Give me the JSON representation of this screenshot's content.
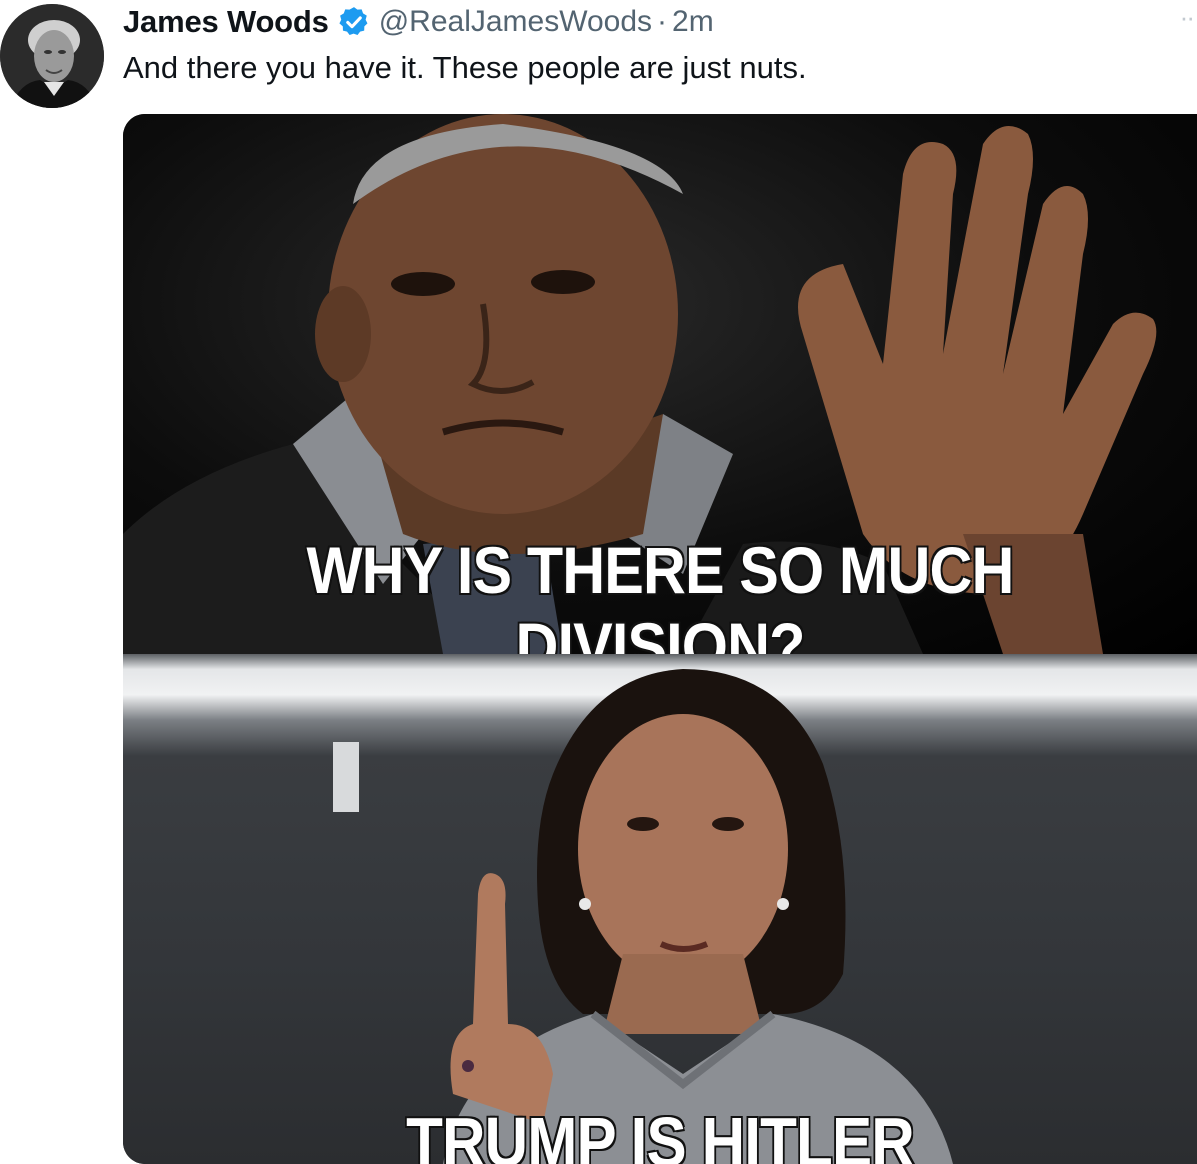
{
  "tweet": {
    "author": {
      "display_name": "James Woods",
      "verified": true,
      "handle": "@RealJamesWoods",
      "separator": "·",
      "time": "2m",
      "avatar_icon": "profile-photo-grayscale"
    },
    "more_icon": "more-horizontal-icon",
    "text": "And there you have it. These people are just nuts.",
    "media": {
      "type": "meme-image",
      "top_caption": "WHY IS THERE SO MUCH DIVISION?",
      "bottom_caption": "TRUMP IS HITLER"
    }
  },
  "colors": {
    "verified_blue": "#1d9bf0",
    "text_primary": "#0f1419",
    "text_secondary": "#536471"
  }
}
